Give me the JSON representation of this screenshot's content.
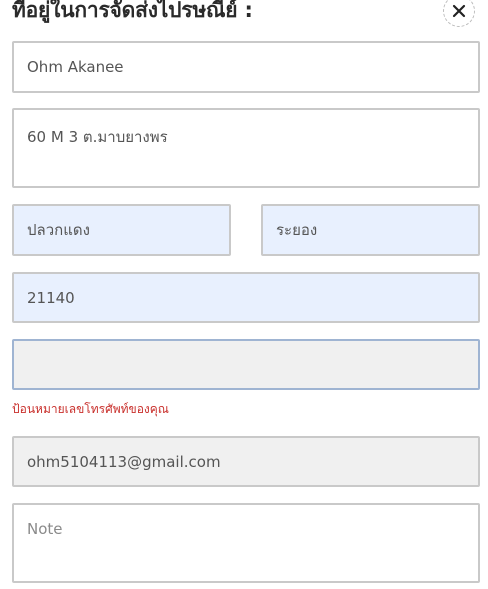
{
  "form": {
    "title": "ที่อยู่ในการจัดส่งไปรษณีย์ :",
    "name_value": "Ohm Akanee",
    "address_value": "60 M 3 ต.มาบยางพร",
    "district_value": "ปลวกแดง",
    "province_value": "ระยอง",
    "postcode_value": "21140",
    "phone_value": "",
    "phone_error": "ป้อนหมายเลขโทรศัพท์ของคุณ",
    "email_value": "ohm5104113@gmail.com",
    "note_placeholder": "Note"
  },
  "colors": {
    "autofill_bg": "#e8f0fe",
    "disabled_bg": "#f0f0f0",
    "error": "#c9302c",
    "focus_border": "#9fb4d2"
  },
  "icons": {
    "close": "close-icon"
  }
}
